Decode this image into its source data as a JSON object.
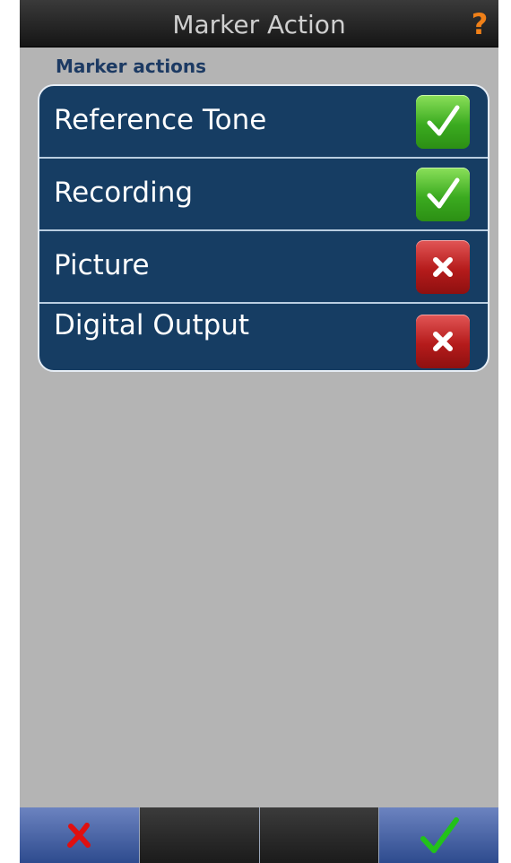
{
  "header": {
    "title": "Marker Action",
    "help_icon": "?"
  },
  "section": {
    "label": "Marker actions"
  },
  "marker_actions": [
    {
      "label": "Reference Tone",
      "enabled": true
    },
    {
      "label": "Recording",
      "enabled": true
    },
    {
      "label": "Picture",
      "enabled": false
    },
    {
      "label": "Digital Output",
      "enabled": false
    }
  ],
  "footer": {
    "cancel_icon": "red-x-icon",
    "confirm_icon": "green-check-icon"
  },
  "colors": {
    "panel": "#163d63",
    "section_label": "#1c3a63",
    "help": "#f08018",
    "on": "#3bab20",
    "off": "#b51b1b",
    "active_button": "#4a64a8"
  }
}
